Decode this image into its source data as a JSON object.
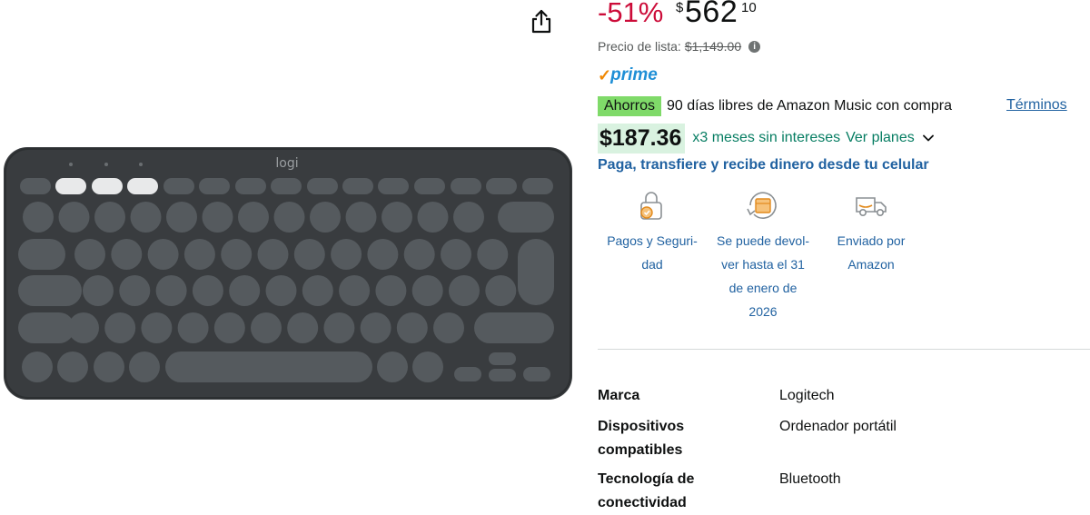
{
  "product_image": {
    "logo_text": "logi"
  },
  "price": {
    "discount": "-51%",
    "currency_symbol": "$",
    "whole": "562",
    "fraction": "10",
    "list_price_label": "Precio de lista:",
    "list_price_value": "$1,149.00",
    "info_icon": "i"
  },
  "prime": {
    "check": "✓",
    "word": "prime"
  },
  "promo": {
    "badge": "Ahorros",
    "text": "90 días libres de Amazon Music con compra",
    "terms_link": "Términos"
  },
  "installments": {
    "amount": "$187.36",
    "months_text": "x3 meses sin intereses",
    "plans_link": "Ver planes"
  },
  "payment_banner": "Paga, transfiere y recibe dinero desde tu celular",
  "features": [
    {
      "icon": "lock-card-icon",
      "lines": [
        "Pagos y Seguri-",
        "dad"
      ]
    },
    {
      "icon": "return-box-icon",
      "lines": [
        "Se puede devol-",
        "ver hasta el 31",
        "de enero de",
        "2026"
      ]
    },
    {
      "icon": "delivery-truck-icon",
      "lines": [
        "Enviado por",
        "Amazon"
      ]
    }
  ],
  "specs": [
    {
      "label_lines": [
        "Marca"
      ],
      "value": "Logitech"
    },
    {
      "label_lines": [
        "Dispositivos",
        "compatibles"
      ],
      "value": "Ordenador portátil"
    },
    {
      "label_lines": [
        "Tecnología de",
        "conectividad"
      ],
      "value": "Bluetooth"
    }
  ],
  "colors": {
    "discount": "#cc0c39",
    "link": "#2162a1",
    "installment_green": "#067d62",
    "badge_green": "#7fda69",
    "prime_blue": "#1f8fd6",
    "prime_check": "#f08804",
    "keyboard_body": "#3a3d40",
    "key": "#555a5e"
  }
}
